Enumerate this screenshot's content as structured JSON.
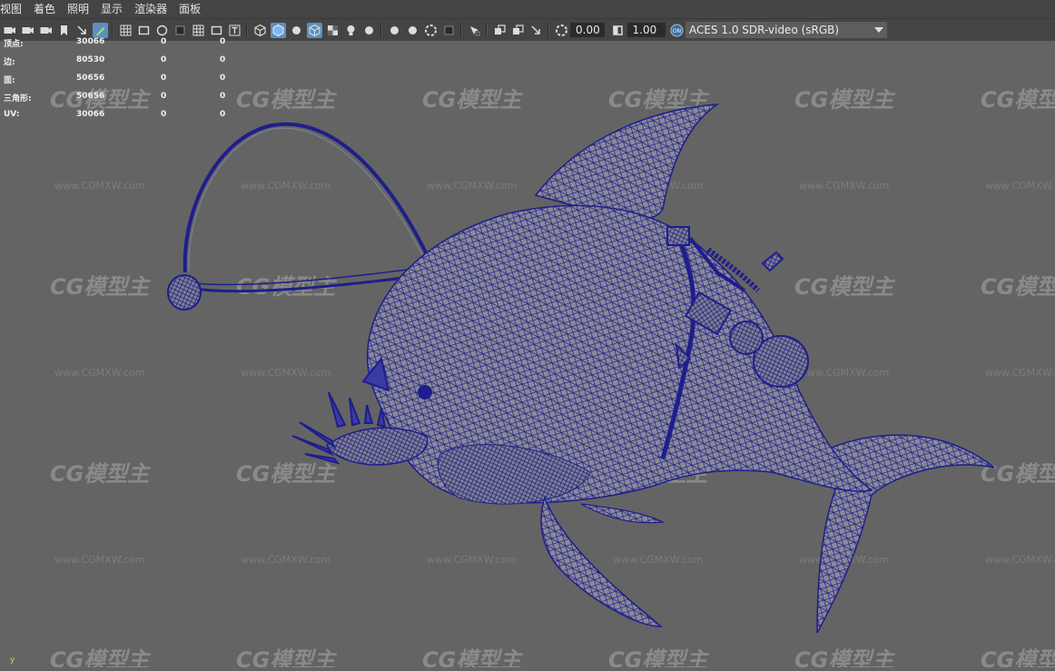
{
  "menu": [
    "视图",
    "着色",
    "照明",
    "显示",
    "渲染器",
    "面板"
  ],
  "toolbar": {
    "icons": [
      "camera-icon",
      "camera-select-icon",
      "camera-lock-icon",
      "bookmark-icon",
      "pan-zoom-icon",
      "grease-pencil-icon",
      "grid-icon",
      "film-gate-icon",
      "resolution-gate-icon",
      "gate-mask-icon",
      "field-chart-icon",
      "safe-action-icon",
      "safe-title-icon",
      "wireframe-icon",
      "smooth-shade-icon",
      "default-lighting-icon",
      "wireframe-on-shaded-icon",
      "textured-icon",
      "use-all-lights-icon",
      "shadows-icon",
      "ambient-occlusion-icon",
      "motion-blur-icon",
      "anti-alias-icon",
      "depth-of-field-icon",
      "isolate-select-icon",
      "xray-icon",
      "xray-joints-icon",
      "backface-icon",
      "exposure-icon",
      "gamma-icon",
      "color-management-icon"
    ],
    "exposure_value": "0.00",
    "gamma_value": "1.00",
    "colorspace": "ACES 1.0 SDR-video (sRGB)"
  },
  "hud": [
    {
      "label": "顶点:",
      "v1": "30066",
      "v2": "0",
      "v3": "0"
    },
    {
      "label": "边:",
      "v1": "80530",
      "v2": "0",
      "v3": "0"
    },
    {
      "label": "面:",
      "v1": "50656",
      "v2": "0",
      "v3": "0"
    },
    {
      "label": "三角形:",
      "v1": "50656",
      "v2": "0",
      "v3": "0"
    },
    {
      "label": "UV:",
      "v1": "30066",
      "v2": "0",
      "v3": "0"
    }
  ],
  "watermark": {
    "logo": "CG模型主",
    "url": "www.CGMXW.com"
  },
  "axis_label": "y",
  "colors": {
    "wire": "#1e1e8c",
    "mesh_fill": "#8a8a96",
    "background": "#646464",
    "toolbar": "#444444"
  }
}
